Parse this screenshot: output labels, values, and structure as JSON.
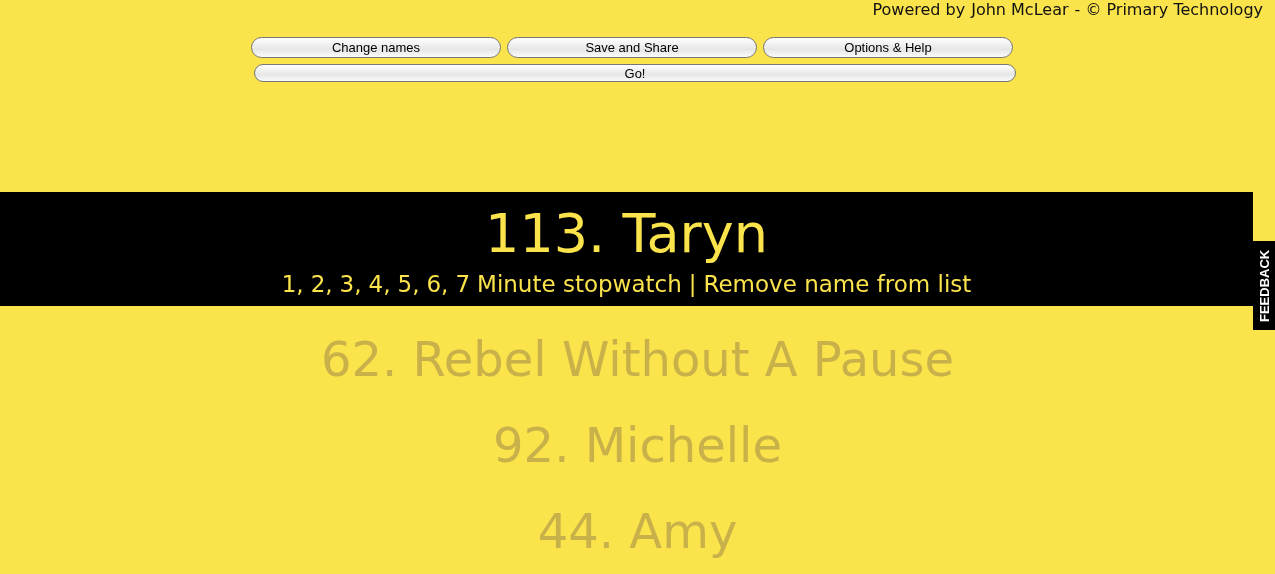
{
  "credit": {
    "prefix": "Powered by",
    "author": "John McLear",
    "suffix": "- © Primary Technology"
  },
  "buttons": [
    "Change names",
    "Save and Share",
    "Options & Help"
  ],
  "go_button": "Go!",
  "current": {
    "name": "113. Taryn",
    "stopwatch_minutes": [
      "1,",
      "2,",
      "3,",
      "4,",
      "5,",
      "6,",
      "7"
    ],
    "stopwatch_label": "Minute stopwatch",
    "separator": "|",
    "remove_link": "Remove name from list"
  },
  "upcoming": [
    "62. Rebel Without A Pause",
    "92. Michelle",
    "44. Amy"
  ],
  "feedback_tab": "FEEDBACK"
}
